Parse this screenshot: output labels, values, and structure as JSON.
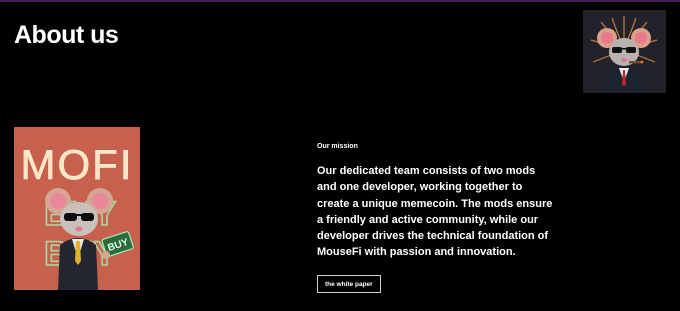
{
  "header": {
    "title": "About us"
  },
  "avatar": {
    "icon": "mouse-agent-avatar"
  },
  "poster": {
    "headline": "MOFI",
    "sign_text": "BUY",
    "neon_rows": [
      "BUY",
      "BUY"
    ],
    "background_color": "#c8604e",
    "neon_color": "#9ff0b0"
  },
  "mission": {
    "label": "Our mission",
    "text": "Our dedicated team consists of two mods and one developer, working together to create a unique memecoin. The mods ensure a friendly and active community, while our developer drives the technical foundation of MouseFi with passion and innovation.",
    "button_label": "the white paper"
  },
  "colors": {
    "background": "#000000",
    "text": "#ffffff",
    "accent_border": "#4a1a5a"
  }
}
